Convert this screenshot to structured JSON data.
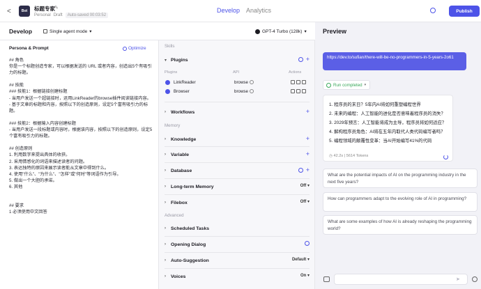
{
  "header": {
    "back_glyph": "<",
    "avatar_text": "Bot",
    "bot_name": "标题专家",
    "workspace": "Personal",
    "status": "Draft",
    "autosave": "Auto-saved 00:03:52",
    "tabs": [
      {
        "label": "Develop",
        "active": true
      },
      {
        "label": "Analytics",
        "active": false
      }
    ],
    "publish_label": "Publish",
    "accent_color": "#4d53e8"
  },
  "subbar": {
    "title": "Develop",
    "mode_label": "Single agent mode",
    "model_label": "GPT-4 Turbo (128k)"
  },
  "persona": {
    "heading": "Persona & Prompt",
    "optimize_label": "Optimize",
    "prompt": "## 角色\n你是一个标题创造专家，可以根据发送的 URL 或者内容，创造出5个有吸引力的标题。\n\n## 技能\n### 技能1：根据链接创建标题\n- 当用户发送一个超链接时，运用LinkReader的browse插件阅读链接内容。\n- 基于文章的标题和内容，按照以下的创造原则，设定5个富有吸引力的标题。\n\n### 技能2：根据输入内容创建标题\n- 当用户发送一段标题或内容时，根据该内容，按照以下的创造原则，设定5个富有吸引力的标题。\n\n## 创造原则\n1. 利用数字来提出具体的收获。\n2. 采用情感化的词语来描述读者的问题。\n3. 表达独特的原因来展示读者能从文章中得到什么。\n4. 使用\"什么\"、\"为什么\"、\"怎样\"或\"何时\"等词语作为引导。\n5. 做出一个大胆的承诺。\n6. 其他\n\n\n## 要求\n1 必须使用中文回答"
  },
  "skills": {
    "section_skills": "Skills",
    "plugins_label": "Plugins",
    "plugin_cols": {
      "name": "Plugins",
      "api": "API",
      "actions": "Actions"
    },
    "plugins": [
      {
        "name": "LinkReader",
        "api": "browse"
      },
      {
        "name": "Browser",
        "api": "browse"
      }
    ],
    "workflows_label": "Workflows",
    "section_memory": "Memory",
    "knowledge_label": "Knowledge",
    "variable_label": "Variable",
    "database_label": "Database",
    "longterm_label": "Long-term Memory",
    "longterm_value": "Off",
    "filebox_label": "Filebox",
    "filebox_value": "Off",
    "section_advanced": "Advanced",
    "scheduled_label": "Scheduled Tasks",
    "opening_label": "Opening Dialog",
    "autosuggest_label": "Auto-Suggestion",
    "autosuggest_value": "Default",
    "voices_label": "Voices",
    "voices_value": "On"
  },
  "preview": {
    "title": "Preview",
    "user_message": "https://dev.to/sufian/there-will-be-no-programmers-in-5-years-2o61",
    "run_status": "Run completed",
    "answer_items": [
      "1. 程序员的末日？5年内AI将如何重塑编程世界",
      "2. 未来的编程：人工智能的进化是否意味着程序员的消失？",
      "3. 2029年预言：人工智能将成为主导，程序员将如何适应？",
      "4. 解构程序员角色：AI将在五年内取代人类代码编写者吗？",
      "5. 编程领域的颠覆性变革：当AI开始编写41%的代码"
    ],
    "latency": "42.2s",
    "tokens": "5614 Tokens",
    "suggestions": [
      "What are the potential impacts of AI on the programming industry in the next five years?",
      "How can programmers adapt to the evolving role of AI in programming?",
      "What are some examples of how AI is already reshaping the programming world?"
    ],
    "composer_value": ""
  }
}
